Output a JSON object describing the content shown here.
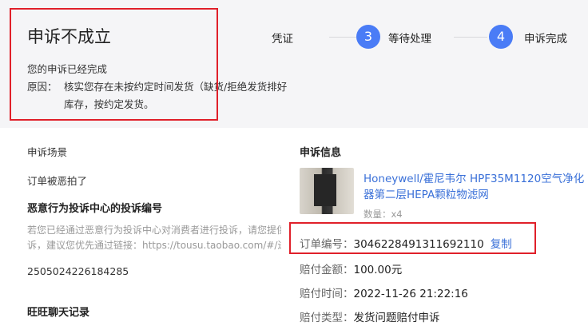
{
  "status": {
    "title": "申诉不成立",
    "subtitle": "您的申诉已经完成",
    "reason_label": "原因：",
    "reason_text": "核实您存在未按约定时间发货（缺货/拒绝发货排好库存，按约定发货。"
  },
  "steps": {
    "cut_label": "凭证",
    "items": [
      {
        "number": "3",
        "label": "等待处理"
      },
      {
        "number": "4",
        "label": "申诉完成"
      }
    ]
  },
  "left": {
    "scene_label": "申诉场景",
    "scene_value": "订单被恶拍了",
    "complaint_title": "恶意行为投诉中心的投诉编号",
    "complaint_desc_1": "若您已经通过恶意行为投诉中心对消费者进行投诉，请您提供",
    "complaint_desc_2": "诉，建议您优先通过链接：https://tousu.taobao.com/#/进",
    "complaint_number": "2505024226184285",
    "chat_title": "旺旺聊天记录"
  },
  "right": {
    "section_title": "申诉信息",
    "product_title": "Honeywell/霍尼韦尔 HPF35M1120空气净化器第二层HEPA颗粒物滤网",
    "quantity": "数量：x4",
    "order_label": "订单编号：",
    "order_number": "3046228491311692110",
    "copy_label": "复制",
    "amount_label": "赔付金额：",
    "amount_value": "100.00元",
    "time_label": "赔付时间：",
    "time_value": "2022-11-26 21:22:16",
    "type_label": "赔付类型：",
    "type_value": "发货问题赔付申诉"
  },
  "colors": {
    "accent": "#4a7cf6",
    "link": "#3a70d8",
    "highlight_box": "#e0202a"
  }
}
